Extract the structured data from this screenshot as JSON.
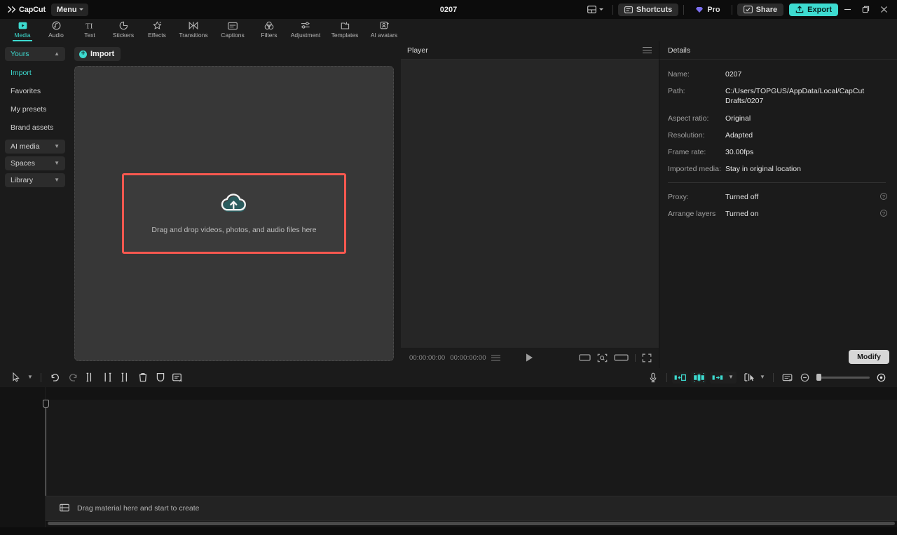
{
  "titlebar": {
    "brand": "CapCut",
    "menu_label": "Menu",
    "project_title": "0207",
    "layout_icon": "layout-grid-icon",
    "buttons": [
      {
        "name": "shortcuts",
        "label": "Shortcuts",
        "icon": "keyboard-icon"
      },
      {
        "name": "pro",
        "label": "Pro",
        "icon": "diamond-icon"
      },
      {
        "name": "share",
        "label": "Share",
        "icon": "share-screen-icon"
      },
      {
        "name": "export",
        "label": "Export",
        "icon": "upload-box-icon"
      }
    ],
    "window_controls": [
      "minimize-icon",
      "restore-icon",
      "close-icon"
    ]
  },
  "tabs": [
    {
      "label": "Media",
      "icon": "media-play-icon",
      "active": true
    },
    {
      "label": "Audio",
      "icon": "audio-note-icon",
      "active": false
    },
    {
      "label": "Text",
      "icon": "text-ti-icon",
      "active": false
    },
    {
      "label": "Stickers",
      "icon": "sticker-clock-icon",
      "active": false
    },
    {
      "label": "Effects",
      "icon": "effects-sparkle-icon",
      "active": false
    },
    {
      "label": "Transitions",
      "icon": "transitions-bowtie-icon",
      "active": false
    },
    {
      "label": "Captions",
      "icon": "captions-box-icon",
      "active": false
    },
    {
      "label": "Filters",
      "icon": "filters-circles-icon",
      "active": false
    },
    {
      "label": "Adjustment",
      "icon": "adjustment-sliders-icon",
      "active": false
    },
    {
      "label": "Templates",
      "icon": "templates-folder-icon",
      "active": false
    },
    {
      "label": "AI avatars",
      "icon": "ai-avatar-icon",
      "active": false
    }
  ],
  "sidebar": {
    "groups": [
      {
        "label": "Yours",
        "type": "group",
        "expanded": true,
        "active": true,
        "chevron": "chevron-up-icon"
      },
      {
        "label": "Import",
        "type": "item",
        "active": true
      },
      {
        "label": "Favorites",
        "type": "item",
        "active": false
      },
      {
        "label": "My presets",
        "type": "item",
        "active": false
      },
      {
        "label": "Brand assets",
        "type": "item",
        "active": false
      },
      {
        "label": "AI media",
        "type": "group",
        "expanded": false,
        "active": false,
        "chevron": "chevron-down-icon"
      },
      {
        "label": "Spaces",
        "type": "group",
        "expanded": false,
        "active": false,
        "chevron": "chevron-down-icon"
      },
      {
        "label": "Library",
        "type": "group",
        "expanded": false,
        "active": false,
        "chevron": "chevron-down-icon"
      }
    ]
  },
  "media_panel": {
    "import_label": "Import",
    "import_icon": "plus-circle-icon",
    "dropzone_icon": "cloud-upload-icon",
    "dropzone_label": "Drag and drop videos, photos, and audio files here",
    "highlight_color": "#f8584f"
  },
  "player": {
    "title": "Player",
    "menu_icon": "hamburger-icon",
    "current_time": "00:00:00:00",
    "total_time": "00:00:00:00",
    "play_icon": "play-icon",
    "controls": [
      "ratio-icon",
      "crop-icon",
      "wide-ratio-icon",
      "fullscreen-icon"
    ]
  },
  "details": {
    "title": "Details",
    "rows": [
      {
        "key": "Name:",
        "value": "0207",
        "help": false
      },
      {
        "key": "Path:",
        "value": "C:/Users/TOPGUS/AppData/Local/CapCut Drafts/0207",
        "help": false
      },
      {
        "key": "Aspect ratio:",
        "value": "Original",
        "help": false
      },
      {
        "key": "Resolution:",
        "value": "Adapted",
        "help": false
      },
      {
        "key": "Frame rate:",
        "value": "30.00fps",
        "help": false
      },
      {
        "key": "Imported media:",
        "value": "Stay in original location",
        "help": false
      }
    ],
    "rows2": [
      {
        "key": "Proxy:",
        "value": "Turned off",
        "help": true
      },
      {
        "key": "Arrange layers",
        "value": "Turned on",
        "help": true
      }
    ],
    "modify_label": "Modify"
  },
  "toolbar": {
    "left_tools": [
      {
        "name": "select-cursor",
        "icon": "cursor-arrow-icon"
      },
      {
        "name": "cursor-dropdown",
        "icon": "chevron-down-icon"
      },
      {
        "name": "undo",
        "icon": "undo-icon"
      },
      {
        "name": "redo",
        "icon": "redo-icon"
      },
      {
        "name": "split",
        "icon": "split-icon"
      },
      {
        "name": "trim-left",
        "icon": "trim-left-icon"
      },
      {
        "name": "trim-right",
        "icon": "trim-right-icon"
      },
      {
        "name": "delete",
        "icon": "trash-icon"
      },
      {
        "name": "mask",
        "icon": "shield-icon"
      },
      {
        "name": "auto-caption",
        "icon": "caption-a-icon"
      }
    ],
    "right_tools": [
      {
        "name": "record-voiceover",
        "icon": "microphone-icon"
      },
      {
        "name": "clip-edit-1",
        "icon": "clip-in-icon"
      },
      {
        "name": "clip-edit-2",
        "icon": "clip-center-icon"
      },
      {
        "name": "clip-edit-3",
        "icon": "clip-out-icon"
      },
      {
        "name": "clip-dropdown",
        "icon": "chevron-down-icon"
      },
      {
        "name": "snap-tool",
        "icon": "magnet-cursor-icon"
      },
      {
        "name": "snap-dropdown",
        "icon": "chevron-down-icon"
      },
      {
        "name": "fit-timeline",
        "icon": "fit-screen-icon"
      },
      {
        "name": "zoom-out",
        "icon": "zoom-out-icon"
      },
      {
        "name": "zoom-in",
        "icon": "zoom-in-icon"
      }
    ]
  },
  "timeline": {
    "drop_label": "Drag material here and start to create",
    "drop_icon": "track-icon",
    "playhead_position": "00:00:00:00"
  }
}
